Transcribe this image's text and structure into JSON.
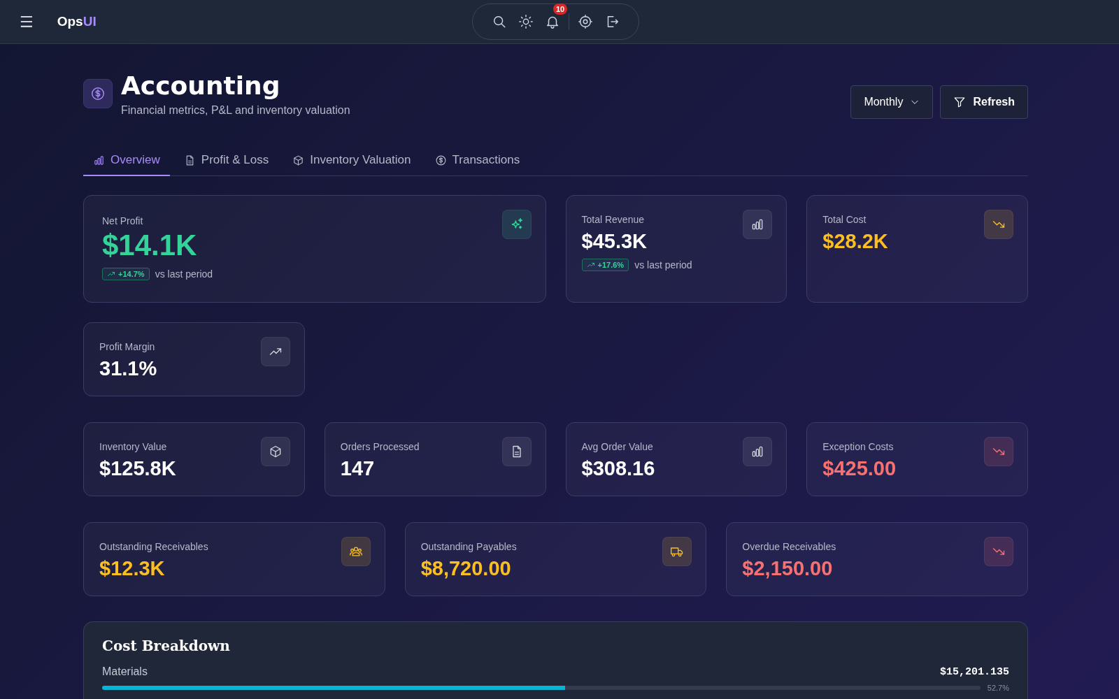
{
  "topbar": {
    "menu": "☰",
    "brand": "Ops",
    "brand_accent": "UI",
    "notifications_count": "10"
  },
  "header": {
    "title": "Accounting",
    "subtitle": "Financial metrics, P&L and inventory valuation",
    "period": "Monthly",
    "refresh": "Refresh"
  },
  "tabs": [
    {
      "label": "Overview",
      "selected": true
    },
    {
      "label": "Profit & Loss",
      "selected": false
    },
    {
      "label": "Inventory Valuation",
      "selected": false
    },
    {
      "label": "Transactions",
      "selected": false
    }
  ],
  "summary_cards": [
    {
      "label": "Net Profit",
      "value": "$14.1K",
      "color": "#34d399",
      "change": "+14.7%",
      "change_note": "vs last period"
    },
    {
      "label": "Total Revenue",
      "value": "$45.3K",
      "color": "#ffffff",
      "change": "+17.6%",
      "change_note": "vs last period"
    },
    {
      "label": "Total Cost",
      "value": "$28.2K",
      "color": "#fbbf24"
    },
    {
      "label": "Profit Margin",
      "value": "31.1%",
      "color": "#ffffff"
    }
  ],
  "operations_cards": [
    {
      "label": "Inventory Value",
      "value": "$125.8K",
      "color": "#ffffff"
    },
    {
      "label": "Orders Processed",
      "value": "147",
      "color": "#ffffff"
    },
    {
      "label": "Avg Order Value",
      "value": "$308.16",
      "color": "#ffffff"
    },
    {
      "label": "Exception Costs",
      "value": "$425.00",
      "color": "#f87171"
    }
  ],
  "balance_cards": [
    {
      "label": "Outstanding Receivables",
      "value": "$12.3K",
      "color": "#fbbf24"
    },
    {
      "label": "Outstanding Payables",
      "value": "$8,720.00",
      "color": "#fbbf24"
    },
    {
      "label": "Overdue Receivables",
      "value": "$2,150.00",
      "color": "#f87171"
    }
  ],
  "cost_breakdown": {
    "title": "Cost Breakdown",
    "items": [
      {
        "name": "Materials",
        "amount": "$15,201.135",
        "level": 0.527,
        "share": "52.7%"
      }
    ]
  }
}
